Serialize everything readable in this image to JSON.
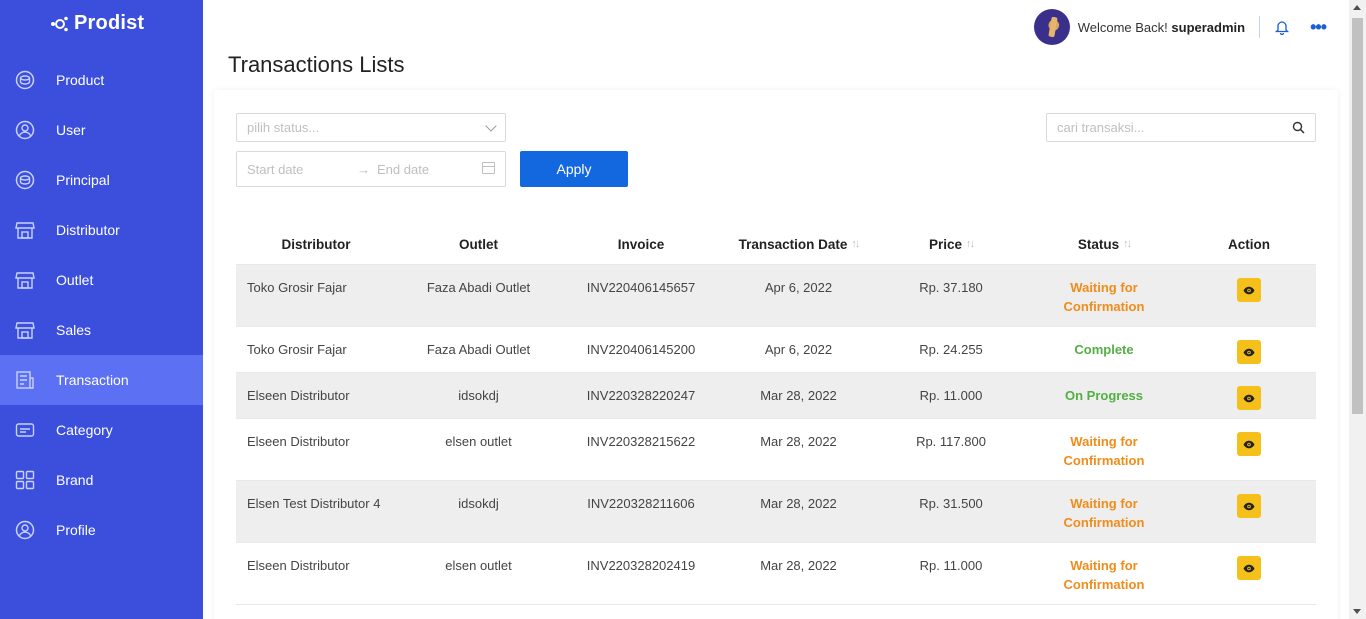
{
  "brand": {
    "name": "Prodist"
  },
  "sidebar": {
    "items": [
      {
        "label": "Product",
        "icon": "product-icon"
      },
      {
        "label": "User",
        "icon": "user-icon"
      },
      {
        "label": "Principal",
        "icon": "principal-icon"
      },
      {
        "label": "Distributor",
        "icon": "store-icon"
      },
      {
        "label": "Outlet",
        "icon": "store-icon"
      },
      {
        "label": "Sales",
        "icon": "store-icon"
      },
      {
        "label": "Transaction",
        "icon": "receipt-icon",
        "active": true
      },
      {
        "label": "Category",
        "icon": "card-icon"
      },
      {
        "label": "Brand",
        "icon": "grid-icon"
      },
      {
        "label": "Profile",
        "icon": "profile-icon"
      }
    ]
  },
  "header": {
    "welcome": "Welcome Back!",
    "username": "superadmin"
  },
  "page": {
    "title": "Transactions Lists"
  },
  "filters": {
    "status_placeholder": "pilih status...",
    "start_date_placeholder": "Start date",
    "end_date_placeholder": "End date",
    "apply_label": "Apply",
    "search_placeholder": "cari transaksi..."
  },
  "table": {
    "columns": [
      "Distributor",
      "Outlet",
      "Invoice",
      "Transaction Date",
      "Price",
      "Status",
      "Action"
    ],
    "rows": [
      {
        "distributor": "Toko Grosir Fajar",
        "outlet": "Faza Abadi Outlet",
        "invoice": "INV220406145657",
        "date": "Apr 6, 2022",
        "price": "Rp. 37.180",
        "status_1": "Waiting for",
        "status_2": "Confirmation",
        "kind": "wait"
      },
      {
        "distributor": "Toko Grosir Fajar",
        "outlet": "Faza Abadi Outlet",
        "invoice": "INV220406145200",
        "date": "Apr 6, 2022",
        "price": "Rp. 24.255",
        "status_1": "Complete",
        "status_2": "",
        "kind": "done"
      },
      {
        "distributor": "Elseen Distributor",
        "outlet": "idsokdj",
        "invoice": "INV220328220247",
        "date": "Mar 28, 2022",
        "price": "Rp. 11.000",
        "status_1": "On Progress",
        "status_2": "",
        "kind": "done"
      },
      {
        "distributor": "Elseen Distributor",
        "outlet": "elsen outlet",
        "invoice": "INV220328215622",
        "date": "Mar 28, 2022",
        "price": "Rp. 117.800",
        "status_1": "Waiting for",
        "status_2": "Confirmation",
        "kind": "wait"
      },
      {
        "distributor": "Elsen Test Distributor 4",
        "outlet": "idsokdj",
        "invoice": "INV220328211606",
        "date": "Mar 28, 2022",
        "price": "Rp. 31.500",
        "status_1": "Waiting for",
        "status_2": "Confirmation",
        "kind": "wait"
      },
      {
        "distributor": "Elseen Distributor",
        "outlet": "elsen outlet",
        "invoice": "INV220328202419",
        "date": "Mar 28, 2022",
        "price": "Rp. 11.000",
        "status_1": "Waiting for",
        "status_2": "Confirmation",
        "kind": "wait"
      }
    ]
  },
  "colors": {
    "sidebar": "#3b4fdc",
    "sidebar_active": "#5b70f2",
    "primary": "#1367df",
    "status_waiting": "#f08c1a",
    "status_complete": "#52b043",
    "action_button": "#f5c01a"
  }
}
